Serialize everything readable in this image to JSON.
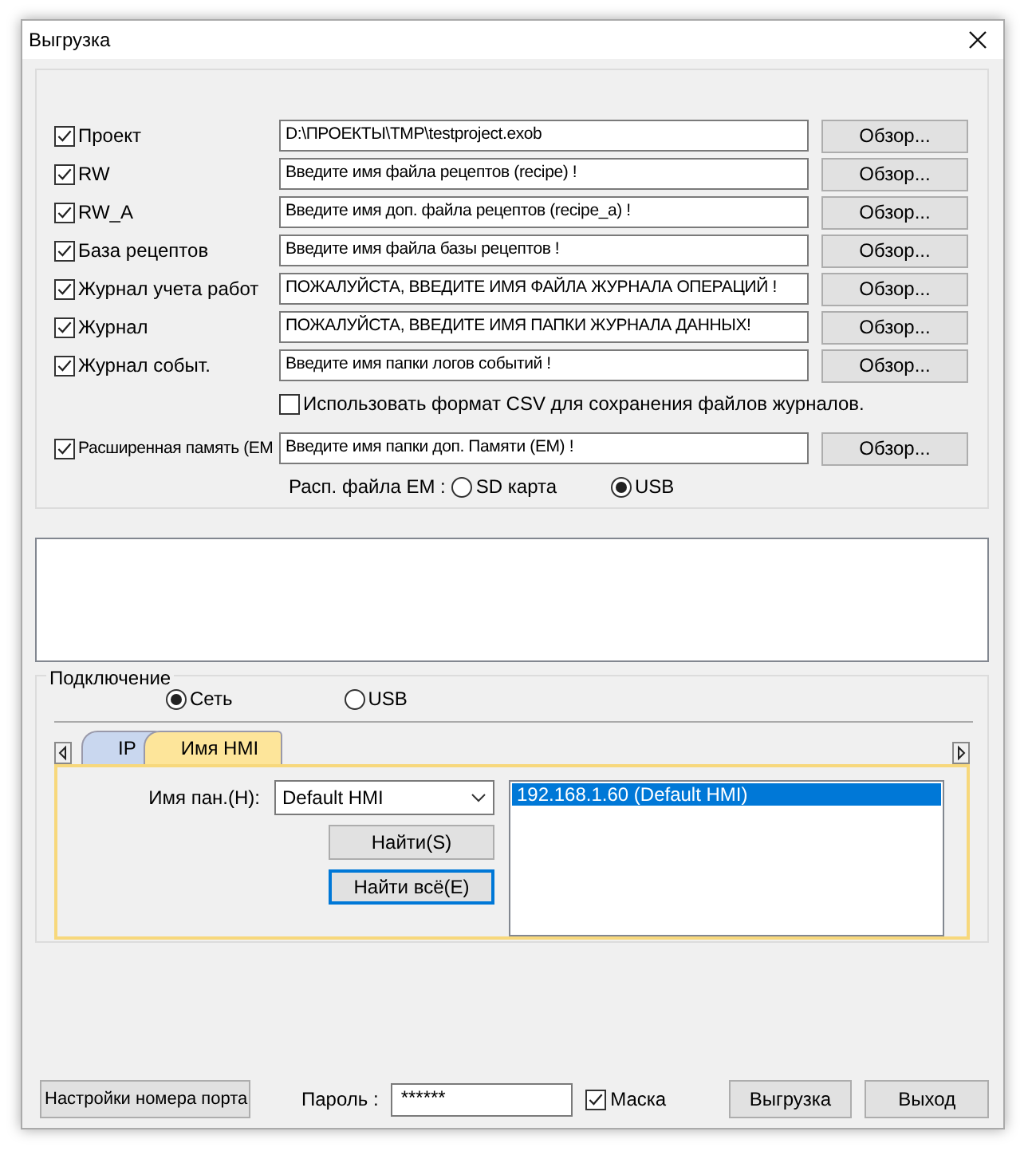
{
  "window": {
    "title": "Выгрузка"
  },
  "files": [
    {
      "label": "Проект",
      "checked": true,
      "value": "D:\\ПРОЕКТЫ\\TMP\\testproject.exob",
      "button": "Обзор..."
    },
    {
      "label": "RW",
      "checked": true,
      "value": "Введите имя файла рецептов (recipe) !",
      "button": "Обзор..."
    },
    {
      "label": "RW_A",
      "checked": true,
      "value": "Введите имя доп. файла рецептов (recipe_a) !",
      "button": "Обзор..."
    },
    {
      "label": "База рецептов",
      "checked": true,
      "value": "Введите имя файла базы рецептов !",
      "button": "Обзор..."
    },
    {
      "label": "Журнал учета работ",
      "checked": true,
      "value": "ПОЖАЛУЙСТА, ВВЕДИТЕ ИМЯ ФАЙЛА ЖУРНАЛА ОПЕРАЦИЙ !",
      "button": "Обзор..."
    },
    {
      "label": "Журнал",
      "checked": true,
      "value": "ПОЖАЛУЙСТА, ВВЕДИТЕ ИМЯ ПАПКИ ЖУРНАЛА ДАННЫХ!",
      "button": "Обзор..."
    },
    {
      "label": "Журнал событ.",
      "checked": true,
      "value": "Введите имя папки логов событий !",
      "button": "Обзор..."
    }
  ],
  "csv": {
    "label": "Использовать формат CSV для сохранения файлов журналов.",
    "checked": false
  },
  "em": {
    "label": "Расширенная память (EM",
    "checked": true,
    "value": "Введите имя папки доп. Памяти (EM) !",
    "button": "Обзор..."
  },
  "em_location": {
    "label": "Расп. файла EM :",
    "options": [
      {
        "label": "SD карта",
        "selected": false
      },
      {
        "label": "USB",
        "selected": true
      }
    ]
  },
  "connection": {
    "title": "Подключение",
    "options": [
      {
        "label": "Сеть",
        "selected": true
      },
      {
        "label": "USB",
        "selected": false
      }
    ],
    "tabs": [
      {
        "label": "IP",
        "selected": false
      },
      {
        "label": "Имя HMI",
        "selected": true
      }
    ],
    "panel_label": "Имя пан.(H):",
    "panel_value": "Default HMI",
    "find_button": "Найти(S)",
    "find_all_button": "Найти всё(E)",
    "hmi_list": [
      {
        "label": "192.168.1.60 (Default HMI)",
        "selected": true
      }
    ]
  },
  "footer": {
    "port_button": "Настройки номера порта",
    "password_label": "Пароль :",
    "password_value": "******",
    "mask": {
      "label": "Маска",
      "checked": true
    },
    "upload_button": "Выгрузка",
    "exit_button": "Выход"
  }
}
